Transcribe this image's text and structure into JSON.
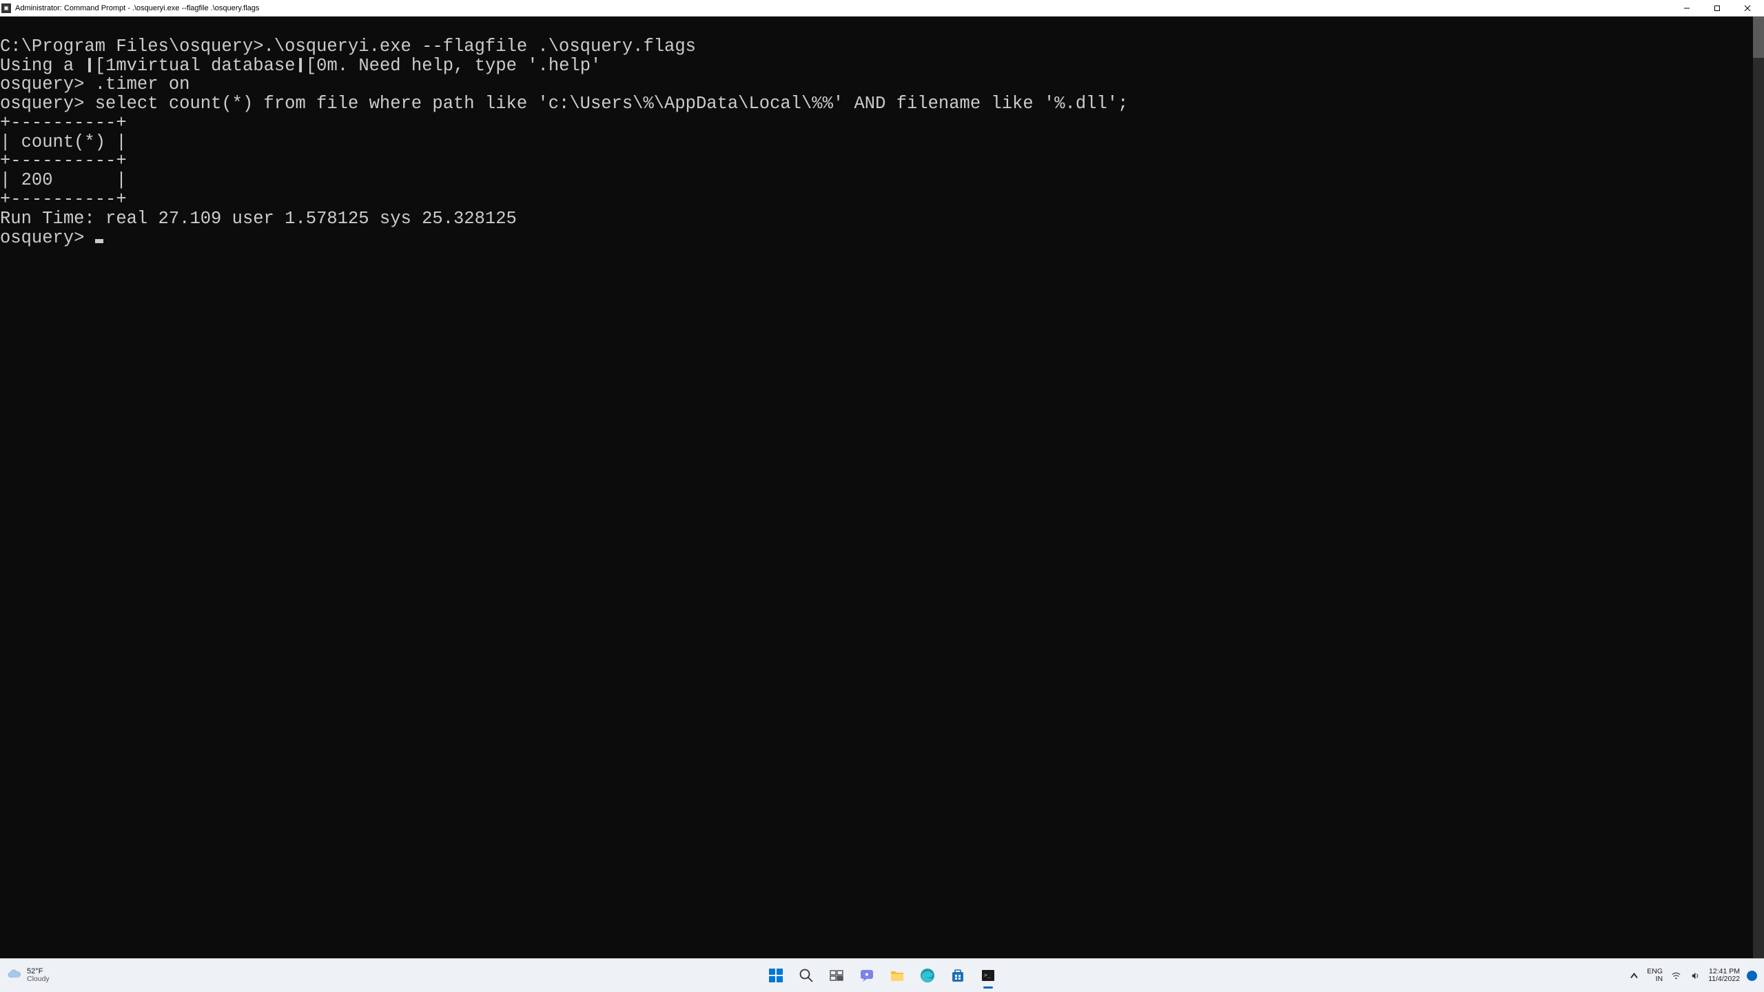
{
  "titlebar": {
    "icon_label": "cmd",
    "title": "Administrator: Command Prompt - .\\osqueryi.exe  --flagfile .\\osquery.flags"
  },
  "terminal": {
    "lines": [
      "C:\\Program Files\\osquery>.\\osqueryi.exe --flagfile .\\osquery.flags",
      "Using a ❙[1mvirtual database❙[0m. Need help, type '.help'",
      "osquery> .timer on",
      "osquery> select count(*) from file where path like 'c:\\Users\\%\\AppData\\Local\\%%' AND filename like '%.dll';",
      "+----------+",
      "| count(*) |",
      "+----------+",
      "| 200      |",
      "+----------+",
      "Run Time: real 27.109 user 1.578125 sys 25.328125",
      "osquery> "
    ]
  },
  "taskbar": {
    "weather": {
      "temp": "52°F",
      "cond": "Cloudy"
    },
    "lang": {
      "code": "ENG",
      "region": "IN"
    },
    "clock": {
      "time": "12:41 PM",
      "date": "11/4/2022"
    }
  }
}
